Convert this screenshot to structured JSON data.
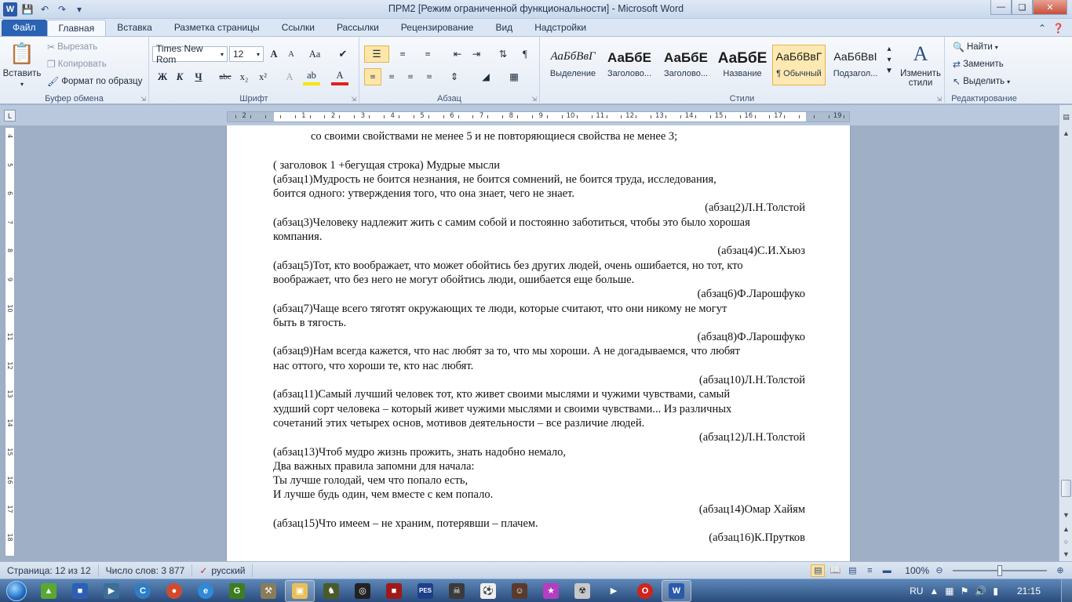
{
  "window": {
    "title": "ПРМ2 [Режим ограниченной функциональности] - Microsoft Word",
    "app_icon": "W"
  },
  "tabs": [
    "Файл",
    "Главная",
    "Вставка",
    "Разметка страницы",
    "Ссылки",
    "Рассылки",
    "Рецензирование",
    "Вид",
    "Надстройки"
  ],
  "ribbon": {
    "clipboard": {
      "paste": "Вставить",
      "cut": "Вырезать",
      "copy": "Копировать",
      "format_painter": "Формат по образцу",
      "label": "Буфер обмена"
    },
    "font": {
      "name": "Times New Rom",
      "size": "12",
      "label": "Шрифт",
      "grow": "A",
      "shrink": "A",
      "case": "Aa",
      "bold": "Ж",
      "italic": "К",
      "underline": "Ч",
      "strike": "abc",
      "sub": "x₂",
      "sup": "x²",
      "highlight": "ab",
      "color": "A"
    },
    "paragraph": {
      "label": "Абзац",
      "pilcrow": "¶"
    },
    "styles": {
      "label": "Стили",
      "items": [
        {
          "sample": "АаБбВвГ",
          "name": "Выделение"
        },
        {
          "sample": "АаБбЕ",
          "name": "Заголово..."
        },
        {
          "sample": "АаБбЕ",
          "name": "Заголово..."
        },
        {
          "sample": "АаБбЕ",
          "name": "Название"
        },
        {
          "sample": "АаБбВвГ",
          "name": "¶ Обычный"
        },
        {
          "sample": "АаБбВвІ",
          "name": "Подзагол..."
        }
      ],
      "change": "Изменить стили"
    },
    "editing": {
      "label": "Редактирование",
      "find": "Найти",
      "replace": "Заменить",
      "select": "Выделить"
    }
  },
  "document": {
    "lines": [
      {
        "text": "со своими свойствами не менее 5 и не повторяющиеся свойства не менее 3;",
        "align": "ind"
      },
      {
        "text": "",
        "align": "l"
      },
      {
        "text": "( заголовок 1 +бегущая строка) Мудрые мысли",
        "align": "l"
      },
      {
        "text": " (абзац1)Мудрость  не боится незнания, не боится сомнений, не боится труда, исследования,",
        "align": "l"
      },
      {
        "text": "боится одного: утверждения того, что она знает, чего не знает.",
        "align": "l"
      },
      {
        "text": "(абзац2)Л.Н.Толстой",
        "align": "r"
      },
      {
        "text": "(абзац3)Человеку надлежит жить с самим собой и постоянно заботиться, чтобы это было хорошая",
        "align": "l"
      },
      {
        "text": "компания.",
        "align": "l"
      },
      {
        "text": "(абзац4)С.И.Хьюз",
        "align": "r"
      },
      {
        "text": "(абзац5)Тот,  кто воображает, что может обойтись без других людей, очень ошибается, но тот, кто",
        "align": "l"
      },
      {
        "text": "воображает, что без него не могут обойтись люди, ошибается еще больше.",
        "align": "l"
      },
      {
        "text": "(абзац6)Ф.Ларошфуко",
        "align": "r"
      },
      {
        "text": "(абзац7)Чаще  всего тяготят окружающих те люди, которые считают, что  они никому не могут",
        "align": "l"
      },
      {
        "text": "быть в тягость.",
        "align": "l"
      },
      {
        "text": "(абзац8)Ф.Ларошфуко",
        "align": "r"
      },
      {
        "text": "(абзац9)Нам всегда кажется, что нас любят за то, что мы хороши. А не догадываемся, что любят",
        "align": "l"
      },
      {
        "text": "нас оттого, что хороши те, кто нас любят.",
        "align": "l"
      },
      {
        "text": "(абзац10)Л.Н.Толстой",
        "align": "r"
      },
      {
        "text": "(абзац11)Самый лучший человек тот, кто живет своими мыслями и чужими чувствами, самый",
        "align": "l"
      },
      {
        "text": "худший сорт человека – который живет чужими мыслями и своими чувствами... Из различных",
        "align": "l"
      },
      {
        "text": "сочетаний этих четырех основ, мотивов деятельности – все различие людей.",
        "align": "l"
      },
      {
        "text": "(абзац12)Л.Н.Толстой",
        "align": "r"
      },
      {
        "text": "(абзац13)Чтоб мудро жизнь прожить, знать надобно немало,",
        "align": "l"
      },
      {
        "text": "Два важных правила запомни для начала:",
        "align": "l"
      },
      {
        "text": "Ты лучше голодай, чем что попало есть,",
        "align": "l"
      },
      {
        "text": "И лучше будь один, чем вместе с кем попало.",
        "align": "l"
      },
      {
        "text": "(абзац14)Омар Хайям",
        "align": "r"
      },
      {
        "text": "(абзац15)Что имеем – не храним, потерявши – плачем.",
        "align": "l"
      },
      {
        "text": "(абзац16)К.Прутков",
        "align": "r"
      }
    ]
  },
  "statusbar": {
    "page": "Страница: 12 из 12",
    "words": "Число слов: 3 877",
    "language": "русский",
    "zoom": "100%",
    "zoom_level": 1.0
  },
  "taskbar": {
    "lang": "RU",
    "time": "21:15"
  },
  "colors": {
    "file_tab": "#2a62b4",
    "selected": "#fde6a7",
    "close": "#c7503b"
  }
}
